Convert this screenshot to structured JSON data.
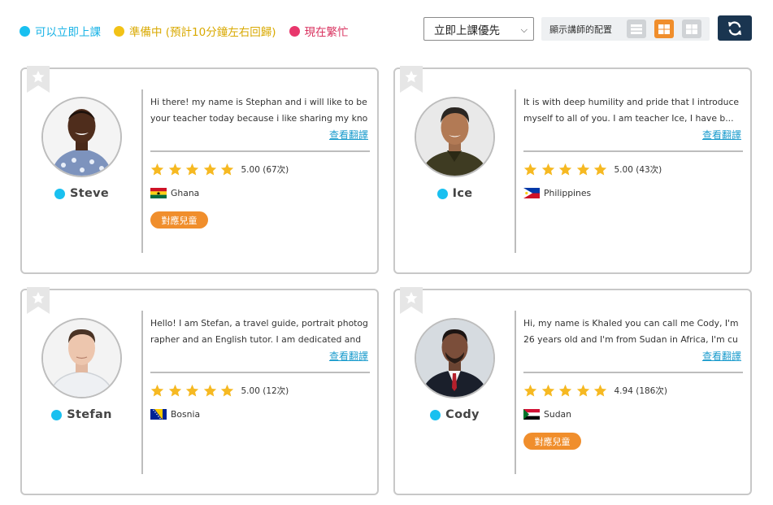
{
  "legend": [
    {
      "label": "可以立即上課",
      "color": "#19c0f0"
    },
    {
      "label": "準備中 (預計10分鐘左右回歸)",
      "color": "#f2c216"
    },
    {
      "label": "現在繁忙",
      "color": "#e8376c"
    }
  ],
  "sort": {
    "selected": "立即上課優先"
  },
  "layout": {
    "label": "顯示講師的配置",
    "active": "grid-2"
  },
  "teachers": [
    {
      "name": "Steve",
      "intro": "Hi there! my name is Stephan and i will like to be your teacher today because i like sharing my know...",
      "translate": "查看翻譯",
      "rating": "5.00 (67次)",
      "country": "Ghana",
      "kids": "對應兒童"
    },
    {
      "name": "Ice",
      "intro": "It is with deep humility and pride that I introduce myself to all of you. I am teacher Ice, I have b...",
      "translate": "查看翻譯",
      "rating": "5.00 (43次)",
      "country": "Philippines",
      "kids": ""
    },
    {
      "name": "Stefan",
      "intro": "Hello! I am Stefan, a travel guide, portrait photographer and an English tutor. I am dedicated and f...",
      "translate": "查看翻譯",
      "rating": "5.00 (12次)",
      "country": "Bosnia",
      "kids": ""
    },
    {
      "name": "Cody",
      "intro": "Hi, my name is Khaled you can call me Cody, I'm 26 years old and I'm from Sudan in Africa, I'm curre...",
      "translate": "查看翻譯",
      "rating": "4.94 (186次)",
      "country": "Sudan",
      "kids": "對應兒童"
    }
  ],
  "icons": {
    "bookmark": "bookmark-star-icon",
    "refresh": "refresh-icon",
    "star": "star-icon"
  },
  "colors": {
    "accent": "#f08e2c",
    "link": "#1c9ccd",
    "navy": "#1a3550",
    "available": "#19c0f0"
  }
}
